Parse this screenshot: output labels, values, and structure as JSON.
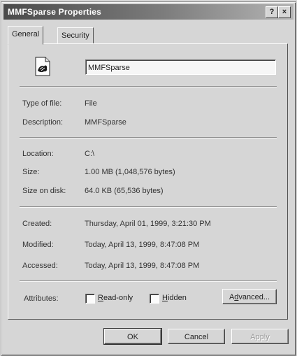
{
  "window": {
    "title": "MMFSparse Properties",
    "help_label": "?",
    "close_label": "×"
  },
  "tabs": [
    {
      "label": "General",
      "active": true
    },
    {
      "label": "Security",
      "active": false
    }
  ],
  "general": {
    "file_name": "MMFSparse",
    "type_label": "Type of file:",
    "type_value": "File",
    "description_label": "Description:",
    "description_value": "MMFSparse",
    "location_label": "Location:",
    "location_value": "C:\\",
    "size_label": "Size:",
    "size_value": "1.00 MB (1,048,576 bytes)",
    "size_on_disk_label": "Size on disk:",
    "size_on_disk_value": "64.0 KB (65,536 bytes)",
    "created_label": "Created:",
    "created_value": "Thursday, April 01, 1999, 3:21:30 PM",
    "modified_label": "Modified:",
    "modified_value": "Today, April 13, 1999, 8:47:08 PM",
    "accessed_label": "Accessed:",
    "accessed_value": "Today, April 13, 1999, 8:47:08 PM",
    "attributes_label": "Attributes:",
    "readonly_label_hotkey": "R",
    "readonly_label_rest": "ead-only",
    "hidden_label_hotkey": "H",
    "hidden_label_rest": "idden",
    "advanced_prefix": "A",
    "advanced_hotkey": "d",
    "advanced_rest": "vanced...",
    "file_icon": "file-icon"
  },
  "buttons": {
    "ok": "OK",
    "cancel": "Cancel",
    "apply": "Apply"
  }
}
